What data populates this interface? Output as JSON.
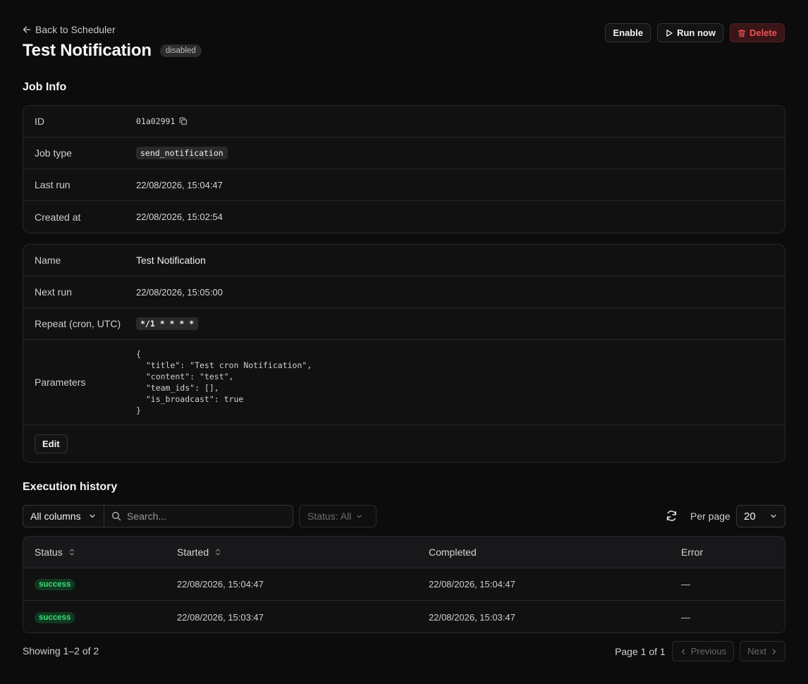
{
  "header": {
    "back_label": "Back to Scheduler",
    "title": "Test Notification",
    "status_badge": "disabled",
    "actions": {
      "enable": "Enable",
      "run_now": "Run now",
      "delete": "Delete"
    }
  },
  "job_info": {
    "section_title": "Job Info",
    "rows": [
      {
        "label": "ID",
        "value": "01a02991"
      },
      {
        "label": "Job type",
        "value": "send_notification"
      },
      {
        "label": "Last run",
        "value": "22/08/2026, 15:04:47"
      },
      {
        "label": "Created at",
        "value": "22/08/2026, 15:02:54"
      }
    ]
  },
  "config": {
    "rows": [
      {
        "label": "Name",
        "value": "Test Notification"
      },
      {
        "label": "Next run",
        "value": "22/08/2026, 15:05:00"
      },
      {
        "label": "Repeat (cron, UTC)",
        "value": "*/1 * * * *"
      },
      {
        "label": "Parameters",
        "value": "{\n  \"title\": \"Test cron Notification\",\n  \"content\": \"test\",\n  \"team_ids\": [],\n  \"is_broadcast\": true\n}"
      }
    ],
    "edit_label": "Edit"
  },
  "history": {
    "section_title": "Execution history",
    "column_select": "All columns",
    "search_placeholder": "Search...",
    "status_filter": "Status: All",
    "per_page_label": "Per page",
    "per_page_value": "20",
    "columns": [
      "Status",
      "Started",
      "Completed",
      "Error"
    ],
    "rows": [
      {
        "status": "success",
        "started": "22/08/2026, 15:04:47",
        "completed": "22/08/2026, 15:04:47",
        "error": "—"
      },
      {
        "status": "success",
        "started": "22/08/2026, 15:03:47",
        "completed": "22/08/2026, 15:03:47",
        "error": "—"
      }
    ],
    "showing": "Showing 1–2 of 2",
    "page_info": "Page 1 of 1",
    "previous": "Previous",
    "next": "Next"
  },
  "colors": {
    "background": "#0c0c0d",
    "success": "#3ddc7b",
    "danger": "#ef5350"
  }
}
